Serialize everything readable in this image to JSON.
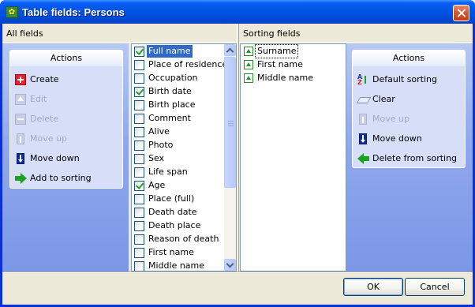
{
  "window": {
    "title": "Table fields: Persons"
  },
  "left": {
    "header": "All fields",
    "actions": {
      "title": "Actions",
      "items": [
        {
          "label": "Create",
          "icon": "create-icon",
          "enabled": true
        },
        {
          "label": "Edit",
          "icon": "edit-icon",
          "enabled": false
        },
        {
          "label": "Delete",
          "icon": "delete-icon",
          "enabled": false
        },
        {
          "label": "Move up",
          "icon": "move-up-icon",
          "enabled": false
        },
        {
          "label": "Move down",
          "icon": "move-down-icon",
          "enabled": true
        },
        {
          "label": "Add to sorting",
          "icon": "add-to-sorting-icon",
          "enabled": true
        }
      ]
    },
    "fields": [
      {
        "label": "Full name",
        "checked": true,
        "selected": true
      },
      {
        "label": "Place of residence",
        "checked": false
      },
      {
        "label": "Occupation",
        "checked": false
      },
      {
        "label": "Birth date",
        "checked": true
      },
      {
        "label": "Birth place",
        "checked": false
      },
      {
        "label": "Comment",
        "checked": false
      },
      {
        "label": "Alive",
        "checked": false
      },
      {
        "label": "Photo",
        "checked": false
      },
      {
        "label": "Sex",
        "checked": false
      },
      {
        "label": "Life span",
        "checked": false
      },
      {
        "label": "Age",
        "checked": true
      },
      {
        "label": "Place (full)",
        "checked": false
      },
      {
        "label": "Death date",
        "checked": false
      },
      {
        "label": "Death place",
        "checked": false
      },
      {
        "label": "Reason of death",
        "checked": false
      },
      {
        "label": "First name",
        "checked": false
      },
      {
        "label": "Middle name",
        "checked": false
      }
    ]
  },
  "right": {
    "header": "Sorting fields",
    "sorting_fields": [
      {
        "label": "Surname",
        "focused": true
      },
      {
        "label": "First name"
      },
      {
        "label": "Middle name"
      }
    ],
    "actions": {
      "title": "Actions",
      "items": [
        {
          "label": "Default sorting",
          "icon": "default-sorting-icon",
          "enabled": true
        },
        {
          "label": "Clear",
          "icon": "clear-icon",
          "enabled": true
        },
        {
          "label": "Move up",
          "icon": "move-up-icon",
          "enabled": false
        },
        {
          "label": "Move down",
          "icon": "move-down-icon",
          "enabled": true
        },
        {
          "label": "Delete from sorting",
          "icon": "delete-from-sorting-icon",
          "enabled": true
        }
      ]
    }
  },
  "buttons": {
    "ok": "OK",
    "cancel": "Cancel"
  }
}
